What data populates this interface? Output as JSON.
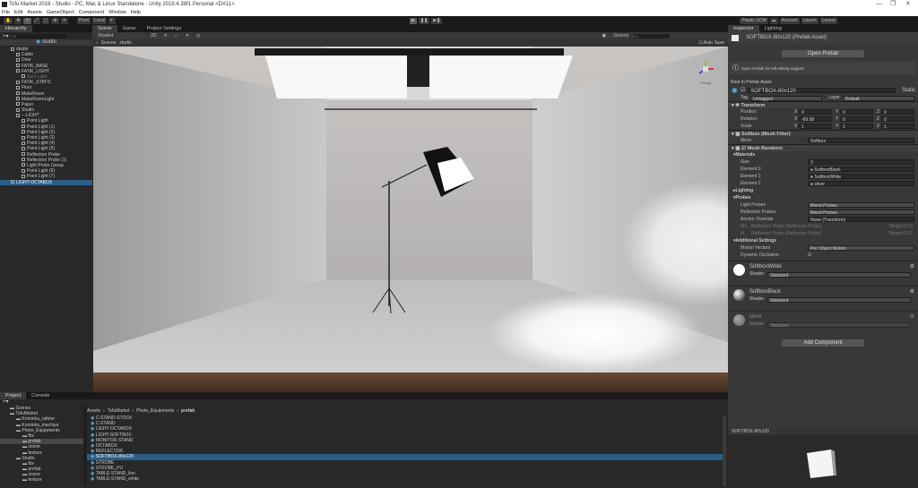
{
  "window": {
    "title": "Tofu Market 2019 - Studio - PC, Mac & Linux Standalone - Unity 2019.4.38f1 Personal <DX11>",
    "minimize": "—",
    "maximize": "❐",
    "close": "✕"
  },
  "menu": [
    "File",
    "Edit",
    "Assets",
    "GameObject",
    "Component",
    "Window",
    "Help"
  ],
  "toolbar": {
    "pivot": "Pivot",
    "local": "Local",
    "plastic": "Plastic SCM",
    "account": "Account",
    "layers": "Layers",
    "layout": "Layout",
    "play": "▶",
    "pause": "❚❚",
    "step": "▶❚"
  },
  "hierarchy": {
    "tab": "Hierarchy",
    "search_placeholder": "All",
    "scene": "studio",
    "items": [
      {
        "label": "studio",
        "depth": 0
      },
      {
        "label": "Cable",
        "depth": 1
      },
      {
        "label": "Door",
        "depth": 1
      },
      {
        "label": "FATIK_BASE",
        "depth": 1
      },
      {
        "label": "FATIK_LIGHT",
        "depth": 1
      },
      {
        "label": "Spot Light",
        "depth": 2,
        "dim": true
      },
      {
        "label": "FATIK_STATIC",
        "depth": 1
      },
      {
        "label": "Floor",
        "depth": 1
      },
      {
        "label": "MakeRoom",
        "depth": 1
      },
      {
        "label": "MakeRoomLight",
        "depth": 1
      },
      {
        "label": "Paper",
        "depth": 1
      },
      {
        "label": "Studio",
        "depth": 1
      },
      {
        "label": "---LIGHT",
        "depth": 1
      },
      {
        "label": "Point Light",
        "depth": 2
      },
      {
        "label": "Point Light (1)",
        "depth": 2
      },
      {
        "label": "Point Light (2)",
        "depth": 2
      },
      {
        "label": "Point Light (3)",
        "depth": 2
      },
      {
        "label": "Point Light (4)",
        "depth": 2
      },
      {
        "label": "Point Light (5)",
        "depth": 2
      },
      {
        "label": "Reflection Probe",
        "depth": 2
      },
      {
        "label": "Reflection Probe (1)",
        "depth": 2
      },
      {
        "label": "Light Probe Group",
        "depth": 2
      },
      {
        "label": "Point Light (6)",
        "depth": 2
      },
      {
        "label": "Point Light (7)",
        "depth": 2
      },
      {
        "label": "LIGHT-OCTABOX",
        "depth": 0,
        "selected": true
      }
    ]
  },
  "scene": {
    "tabs": [
      "Scene",
      "Game",
      "Project Settings"
    ],
    "active_tab": "Scene",
    "shading": "Shaded",
    "mode2d": "2D",
    "gizmos": "Gizmos",
    "search": "All",
    "breadcrumb_back": "Scenes",
    "breadcrumb": "studio",
    "auto_save": "Auto Save",
    "persp": "<Persp"
  },
  "inspector": {
    "tabs": [
      "Inspector",
      "Lighting"
    ],
    "asset_title": "SOFTBOX-80x120 (Prefab Asset)",
    "open_prefab": "Open Prefab",
    "info": "Open Prefab for full editing support.",
    "root_label": "Root in Prefab Asset",
    "object_name": "SOFTBOX-80x120",
    "static": "Static",
    "tag_label": "Tag",
    "tag": "Untagged",
    "layer_label": "Layer",
    "layer": "Default",
    "transform": {
      "title": "Transform",
      "rows": [
        {
          "label": "Position",
          "x": "0",
          "y": "0",
          "z": "0"
        },
        {
          "label": "Rotation",
          "x": "-89.98",
          "y": "0",
          "z": "0"
        },
        {
          "label": "Scale",
          "x": "1",
          "y": "1",
          "z": "1"
        }
      ]
    },
    "mesh_filter": {
      "title": "Softbox (Mesh Filter)",
      "mesh_label": "Mesh",
      "mesh": "Softbox"
    },
    "mesh_renderer": {
      "title": "Mesh Renderer",
      "materials": "Materials",
      "size_label": "Size",
      "size": "3",
      "elements": [
        {
          "label": "Element 0",
          "value": "SoftboxBlack"
        },
        {
          "label": "Element 1",
          "value": "SoftboxWhite"
        },
        {
          "label": "Element 2",
          "value": "silver"
        }
      ],
      "lighting": "Lighting",
      "probes": "Probes",
      "light_probes_label": "Light Probes",
      "light_probes": "Blend Probes",
      "reflection_probes_label": "Reflection Probes",
      "reflection_probes": "Blend Probes",
      "anchor_label": "Anchor Override",
      "anchor": "None (Transform)",
      "probe_rows": [
        {
          "prefix": "ßfs",
          "text": "Reflection Probe (Reflection Probe)",
          "weight": "Weight 0.70"
        },
        {
          "prefix": "ßf",
          "text": "Reflection Probe (Reflection Probe)",
          "weight": "Weight 0.31"
        }
      ],
      "additional": "Additional Settings",
      "motion_label": "Motion Vectors",
      "motion": "Per Object Motion",
      "occlusion_label": "Dynamic Occlusion"
    },
    "materials": [
      {
        "name": "SoftboxWhite",
        "shader_label": "Shader",
        "shader": "Standard",
        "color": "#ffffff"
      },
      {
        "name": "SoftboxBlack",
        "shader_label": "Shader",
        "shader": "Standard",
        "color": "#1a1a1a"
      },
      {
        "name": "silver",
        "shader_label": "Shader",
        "shader": "Standard",
        "color": "#888888"
      }
    ],
    "add_component": "Add Component",
    "preview_title": "SOFTBOX-80x120"
  },
  "project": {
    "tabs": [
      "Project",
      "Console"
    ],
    "tree": [
      {
        "label": "Scenes",
        "depth": 1
      },
      {
        "label": "TofuMarket",
        "depth": 1
      },
      {
        "label": "Kominka_rafeter",
        "depth": 2
      },
      {
        "label": "Kominka_machiya",
        "depth": 2
      },
      {
        "label": "Photo_Equipments",
        "depth": 2
      },
      {
        "label": "fbx",
        "depth": 3
      },
      {
        "label": "prefab",
        "depth": 3,
        "selected": true
      },
      {
        "label": "scene",
        "depth": 3
      },
      {
        "label": "texture",
        "depth": 3
      },
      {
        "label": "Studio",
        "depth": 2
      },
      {
        "label": "fbx",
        "depth": 3
      },
      {
        "label": "prefab",
        "depth": 3
      },
      {
        "label": "scene",
        "depth": 3
      },
      {
        "label": "texture",
        "depth": 3
      }
    ],
    "breadcrumb": [
      "Assets",
      "TofuMarket",
      "Photo_Equipments",
      "prefab"
    ],
    "files": [
      "C-STAND-STOCK",
      "C-STAND",
      "LIGHT-OCTABOX",
      "LIGHT-SOFTBOX",
      "MONITOR-STAND",
      "OCTABOX",
      "REFLECTOR",
      "SOFTBOX-80x120",
      "STROBE",
      "STROBE_PU",
      "TABLE-STAND_line",
      "TABLE-STAND_white"
    ],
    "selected_file": "SOFTBOX-80x120"
  },
  "colors": {
    "selection": "#2c5d87",
    "panel": "#282828",
    "header": "#191919",
    "accent_icon": "#5ab0e6"
  }
}
